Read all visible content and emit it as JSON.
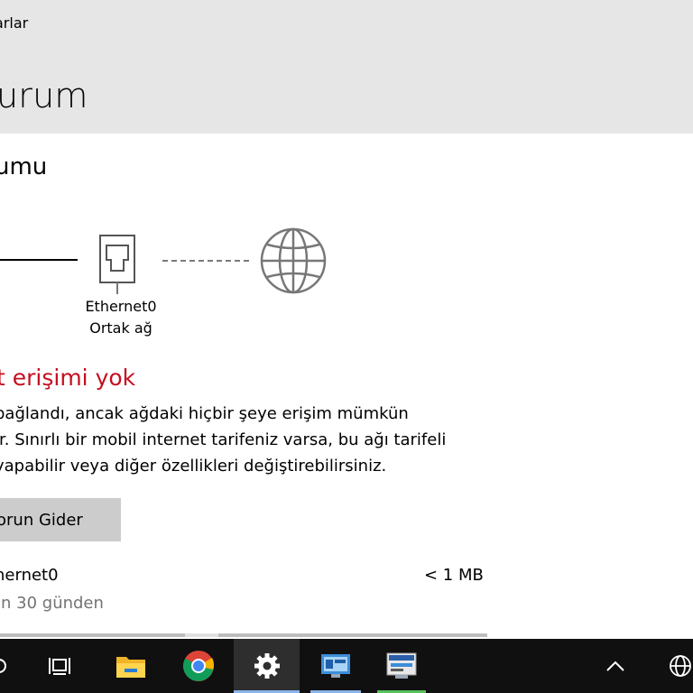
{
  "header": {
    "breadcrumb": "arlar",
    "page_title": "urum"
  },
  "network_status": {
    "section_title": "umu",
    "adapter_name": "Ethernet0",
    "network_type": "Ortak ağ",
    "status_heading": "t erişimi yok",
    "description_lines": [
      "bağlandı, ancak ağdaki hiçbir şeye erişim mümkün",
      "ir. Sınırlı bir mobil internet tarifeniz varsa, bu ağı tarifeli",
      "yapabilir veya diğer özellikleri değiştirebilirsiniz."
    ],
    "troubleshoot_label": "orun Gider"
  },
  "usage": {
    "adapter": "hernet0",
    "amount": "< 1 MB",
    "period": "on 30 günden",
    "fraction_used": 0.0
  },
  "colors": {
    "header_bg": "#e6e6e6",
    "error_red": "#c50f1f",
    "button_bg": "#cccccc",
    "taskbar_bg": "#101010"
  },
  "taskbar": {
    "icons": [
      "search-icon",
      "task-view-icon",
      "file-explorer-icon",
      "chrome-icon",
      "settings-icon",
      "control-panel-icon",
      "network-app-icon",
      "chevron-up-icon",
      "network-globe-icon"
    ]
  }
}
